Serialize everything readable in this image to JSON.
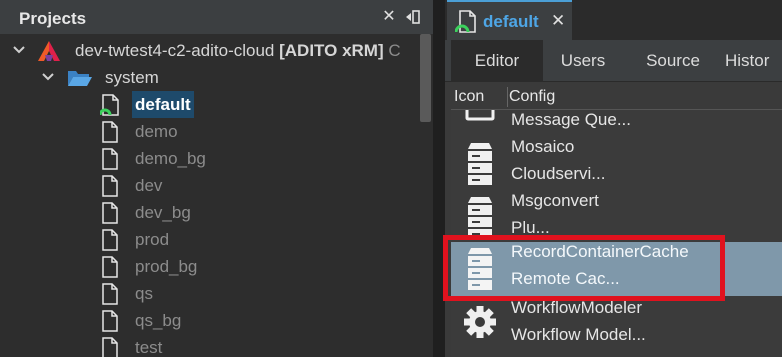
{
  "projects": {
    "title": "Projects",
    "close_glyph": "✕",
    "minimize_glyph": "◂▯"
  },
  "tree": {
    "root": {
      "label": "dev-twtest4-c2-adito-cloud",
      "bold_suffix": "[ADITO xRM]",
      "trailing": "C"
    },
    "system": {
      "label": "system"
    },
    "files": [
      {
        "label": "default",
        "selected": true
      },
      {
        "label": "demo"
      },
      {
        "label": "demo_bg"
      },
      {
        "label": "dev"
      },
      {
        "label": "dev_bg"
      },
      {
        "label": "prod"
      },
      {
        "label": "prod_bg"
      },
      {
        "label": "qs"
      },
      {
        "label": "qs_bg"
      },
      {
        "label": "test"
      }
    ]
  },
  "editor": {
    "doc_tab": {
      "label": "default",
      "close_glyph": "✕"
    },
    "tabs": [
      {
        "label": "Editor",
        "active": true
      },
      {
        "label": "Users"
      },
      {
        "label": "Source"
      },
      {
        "label": "Histor"
      }
    ],
    "columns": {
      "icon": "Icon",
      "config": "Config"
    },
    "items": [
      {
        "line1": "Message Que...",
        "line2": "",
        "icon": "partial-icon"
      },
      {
        "line1": "Mosaico",
        "line2": "Cloudservi...",
        "icon": "server-icon"
      },
      {
        "line1": "Msgconvert",
        "line2": "Plu...",
        "icon": "server-icon"
      },
      {
        "line1": "RecordContainerCache",
        "line2": "Remote Cac...",
        "icon": "server-icon",
        "selected": true
      },
      {
        "line1": "WorkflowModeler",
        "line2": "Workflow Model...",
        "icon": "gear-icon"
      }
    ]
  },
  "colors": {
    "accent": "#4ea6e6",
    "selection": "#7f98aa",
    "highlight": "#e0121e"
  }
}
